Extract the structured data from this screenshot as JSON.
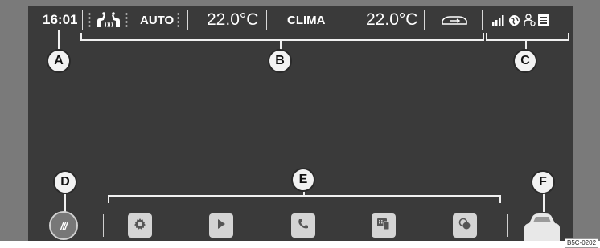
{
  "status_bar": {
    "time": "16:01",
    "mode": "AUTO",
    "temp_left": "22.0°C",
    "title": "CLIMA",
    "temp_right": "22.0°C"
  },
  "callouts": [
    "A",
    "B",
    "C",
    "D",
    "E",
    "F"
  ],
  "bottom_bar": {
    "climate_button_label": "///"
  },
  "figure_code": "B5C-0202"
}
